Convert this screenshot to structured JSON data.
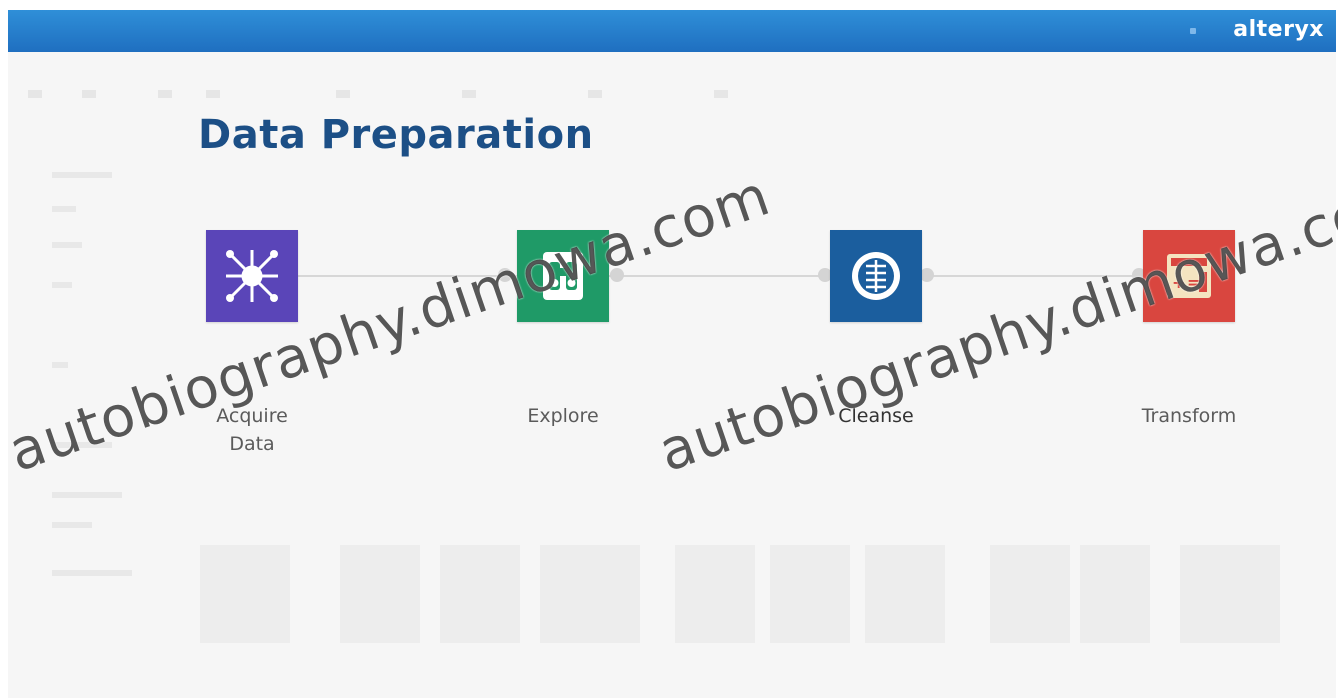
{
  "app": {
    "brand": "alteryx"
  },
  "slide": {
    "title": "Data Preparation",
    "steps": [
      {
        "label": "Acquire\nData",
        "icon": "network-hub-icon",
        "color": "#5a45b8"
      },
      {
        "label": "Explore",
        "icon": "binoculars-icon",
        "color": "#1f9a67"
      },
      {
        "label": "Cleanse",
        "icon": "data-cleanse-icon",
        "color": "#1b5e9e"
      },
      {
        "label": "Transform",
        "icon": "calculator-icon",
        "color": "#d9463f"
      }
    ]
  },
  "watermark": {
    "text_1": "autobiography.dimowa.com",
    "text_2": "autobiography.dimowa.com"
  },
  "colors": {
    "header": "#1f6fc0",
    "title": "#1c4f86",
    "connector": "#d7d7d7"
  }
}
